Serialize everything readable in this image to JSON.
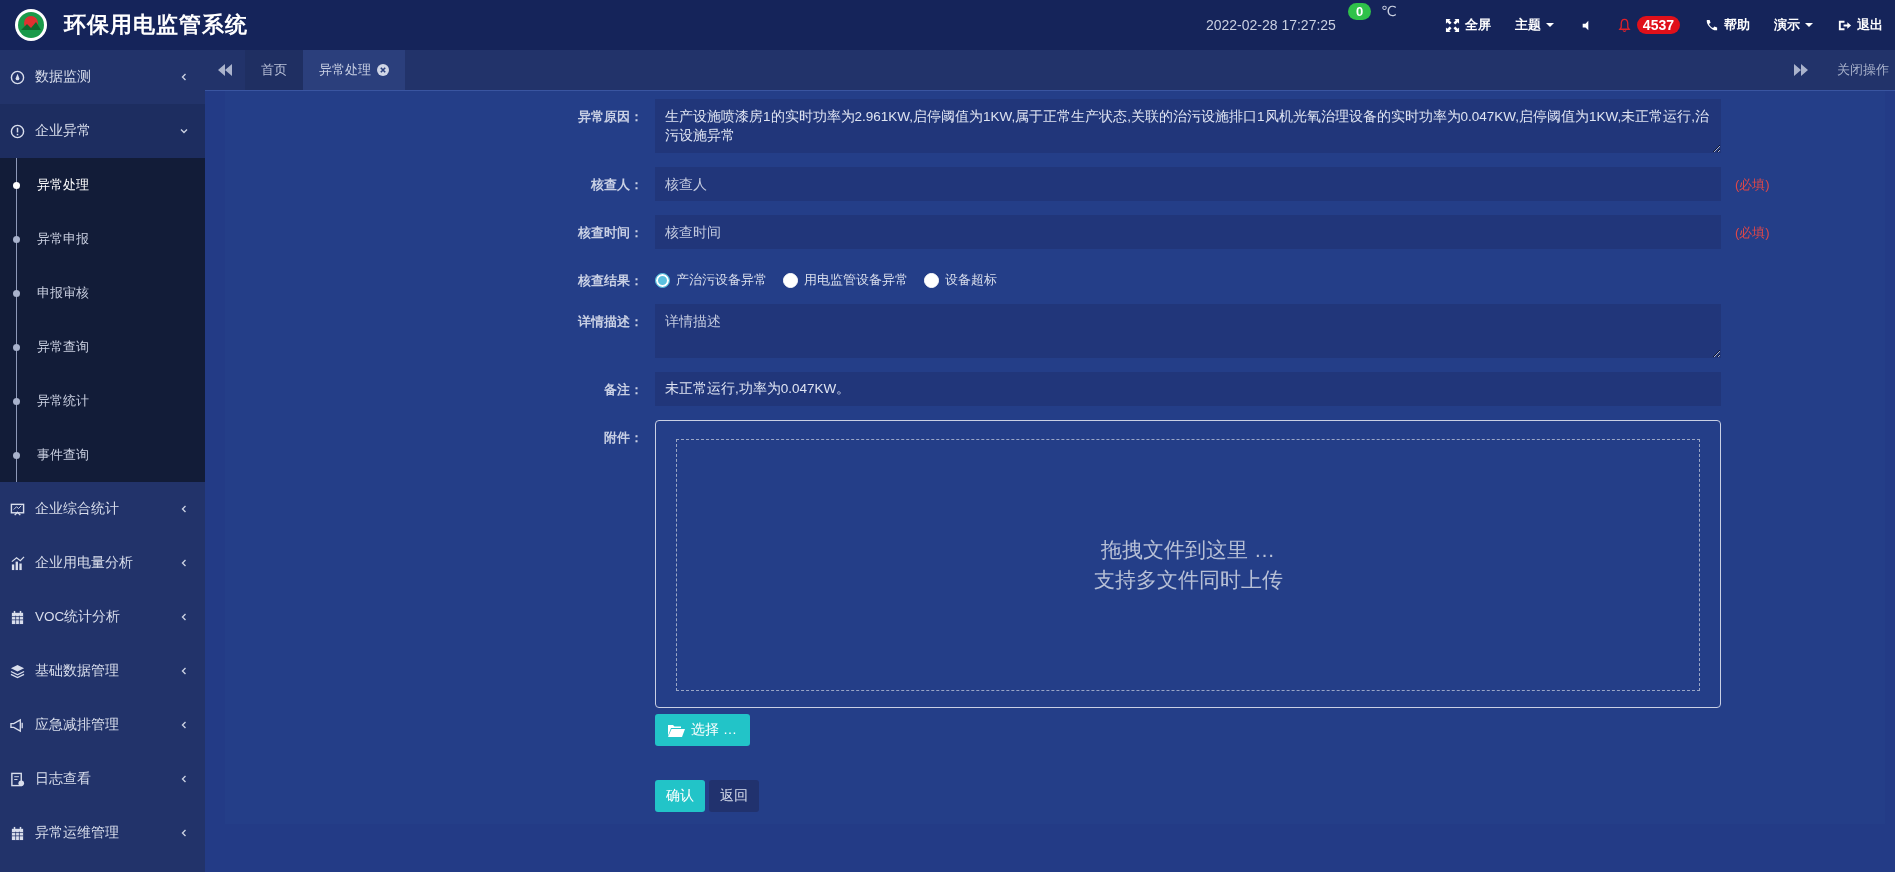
{
  "header": {
    "title": "环保用电监管系统",
    "datetime": "2022-02-28  17:27:25",
    "temp_badge": "0",
    "temp_unit": "℃",
    "toolbar": [
      {
        "kind": "button",
        "label": "全屏"
      },
      {
        "kind": "dropdown",
        "label": "主题"
      },
      {
        "kind": "icon"
      },
      {
        "kind": "alert",
        "badge": "4537"
      },
      {
        "kind": "button",
        "label": "帮助"
      },
      {
        "kind": "dropdown",
        "label": "演示"
      },
      {
        "kind": "button",
        "label": "退出"
      }
    ]
  },
  "sidebar": {
    "items": [
      {
        "label": "数据监测",
        "expanded": false
      },
      {
        "label": "企业异常",
        "expanded": true,
        "children": [
          {
            "label": "异常处理",
            "selected": true
          },
          {
            "label": "异常申报",
            "selected": false
          },
          {
            "label": "申报审核",
            "selected": false
          },
          {
            "label": "异常查询",
            "selected": false
          },
          {
            "label": "异常统计",
            "selected": false
          },
          {
            "label": "事件查询",
            "selected": false
          }
        ]
      },
      {
        "label": "企业综合统计",
        "expanded": false
      },
      {
        "label": "企业用电量分析",
        "expanded": false
      },
      {
        "label": "VOC统计分析",
        "expanded": false
      },
      {
        "label": "基础数据管理",
        "expanded": false
      },
      {
        "label": "应急减排管理",
        "expanded": false
      },
      {
        "label": "日志查看",
        "expanded": false
      },
      {
        "label": "异常运维管理",
        "expanded": false
      }
    ]
  },
  "tabs": [
    {
      "label": "首页",
      "selected": false,
      "closable": false
    },
    {
      "label": "异常处理",
      "selected": true,
      "closable": true
    }
  ],
  "close_ops": "关闭操作",
  "form": {
    "fields": [
      {
        "kind": "textarea",
        "label": "异常原因：",
        "value": "生产设施喷漆房1的实时功率为2.961KW,启停阈值为1KW,属于正常生产状态,关联的治污设施排口1风机光氧治理设备的实时功率为0.047KW,启停阈值为1KW,未正常运行,治污设施异常"
      },
      {
        "kind": "input",
        "label": "核查人：",
        "placeholder": "核查人",
        "required": "(必填)"
      },
      {
        "kind": "input",
        "label": "核查时间：",
        "placeholder": "核查时间",
        "required": "(必填)"
      },
      {
        "kind": "radio",
        "label": "核查结果：",
        "options": [
          {
            "label": "产治污设备异常",
            "selected": true
          },
          {
            "label": "用电监管设备异常",
            "selected": false
          },
          {
            "label": "设备超标",
            "selected": false
          }
        ]
      },
      {
        "kind": "textarea",
        "label": "详情描述：",
        "placeholder": "详情描述"
      },
      {
        "kind": "input",
        "label": "备注：",
        "value": "未正常运行,功率为0.047KW。"
      },
      {
        "kind": "upload",
        "label": "附件：",
        "drop_text": [
          "拖拽文件到这里 …",
          "支持多文件同时上传"
        ],
        "button": "选择 …"
      }
    ],
    "actions": [
      {
        "label": "确认",
        "kind": "primary"
      },
      {
        "label": "返回",
        "kind": "secondary"
      }
    ]
  }
}
